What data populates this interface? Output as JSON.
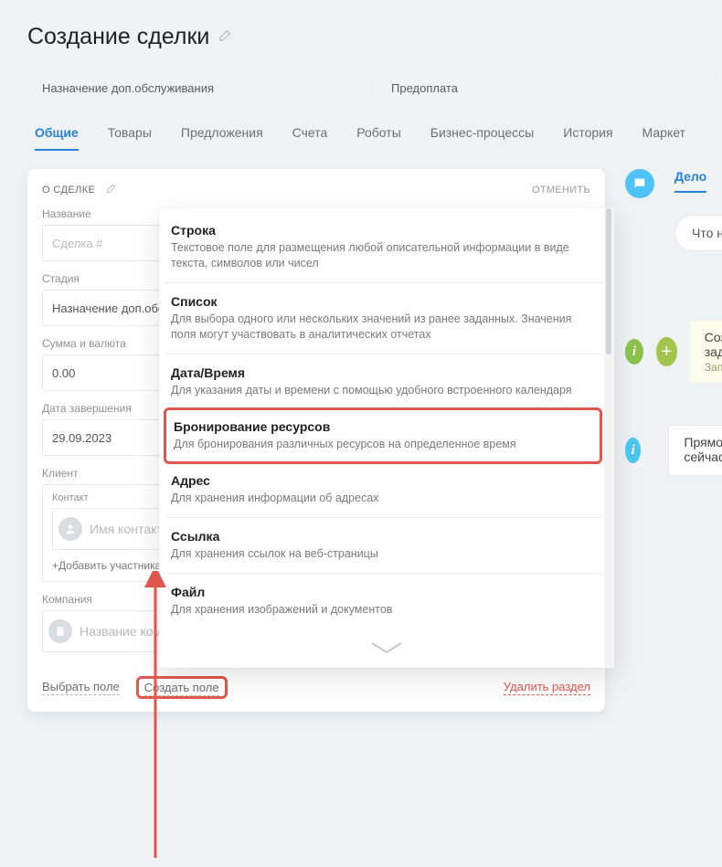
{
  "page_title": "Создание сделки",
  "stages": [
    "Назначение доп.обслуживания",
    "Предоплата"
  ],
  "tabs": [
    "Общие",
    "Товары",
    "Предложения",
    "Счета",
    "Роботы",
    "Бизнес-процессы",
    "История",
    "Маркет"
  ],
  "active_tab_index": 0,
  "card": {
    "section_title": "О СДЕЛКЕ",
    "cancel": "ОТМЕНИТЬ",
    "fields": {
      "name_label": "Название",
      "name_placeholder": "Сделка #",
      "stage_label": "Стадия",
      "stage_value": "Назначение доп.обслуживания",
      "sum_label": "Сумма и валюта",
      "sum_value": "0.00",
      "date_label": "Дата завершения",
      "date_value": "29.09.2023",
      "client_label": "Клиент",
      "contact_label": "Контакт",
      "contact_placeholder": "Имя контакта",
      "add_participant": "+Добавить участника",
      "company_label": "Компания",
      "company_placeholder": "Название компании"
    },
    "footer": {
      "choose_field": "Выбрать поле",
      "create_field": "Создать поле",
      "delete_section": "Удалить раздел"
    }
  },
  "dropdown": [
    {
      "title": "Строка",
      "desc": "Текстовое поле для размещения любой описательной информации в виде текста, символов или чисел"
    },
    {
      "title": "Список",
      "desc": "Для выбора одного или нескольких значений из ранее заданных. Значения поля могут участвовать в аналитических отчетах"
    },
    {
      "title": "Дата/Время",
      "desc": "Для указания даты и времени с помощью удобного встроенного календаря"
    },
    {
      "title": "Бронирование ресурсов",
      "desc": "Для бронирования различных ресурсов на определенное время",
      "highlighted": true
    },
    {
      "title": "Адрес",
      "desc": "Для хранения информации об адресах"
    },
    {
      "title": "Ссылка",
      "desc": "Для хранения ссылок на веб-страницы"
    },
    {
      "title": "Файл",
      "desc": "Для хранения изображений и документов"
    }
  ],
  "timeline": {
    "tab": "Дело",
    "placeholder_pill": "Что нужно сделать",
    "item1_title": "Создана новая задача",
    "item1_sub": "Запланирована",
    "item2_title": "Прямо сейчас"
  }
}
